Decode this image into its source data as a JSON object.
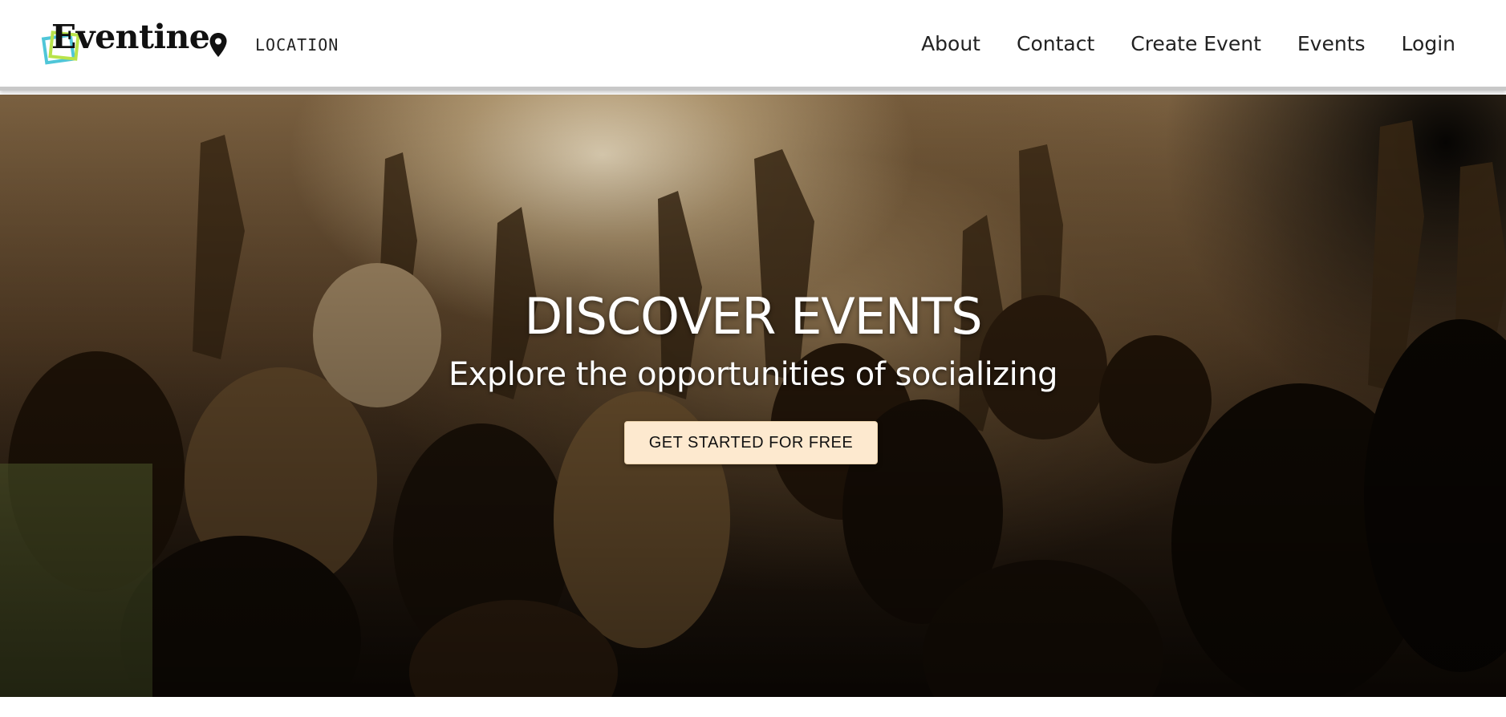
{
  "header": {
    "brand": {
      "name": "Eventine",
      "icon": "logo-squares-icon",
      "colors": {
        "cyan": "#4fc6d8",
        "lime": "#b9e34a"
      }
    },
    "location": {
      "icon": "map-pin-icon",
      "label": "LOCATION"
    },
    "nav": [
      {
        "label": "About"
      },
      {
        "label": "Contact"
      },
      {
        "label": "Create Event"
      },
      {
        "label": "Events"
      },
      {
        "label": "Login"
      }
    ]
  },
  "hero": {
    "image": "concert-crowd-hands-raised",
    "title": "DISCOVER EVENTS",
    "subtitle": "Explore the opportunities of socializing",
    "cta_label": "GET STARTED FOR FREE",
    "cta_color": "#fde9cf"
  }
}
